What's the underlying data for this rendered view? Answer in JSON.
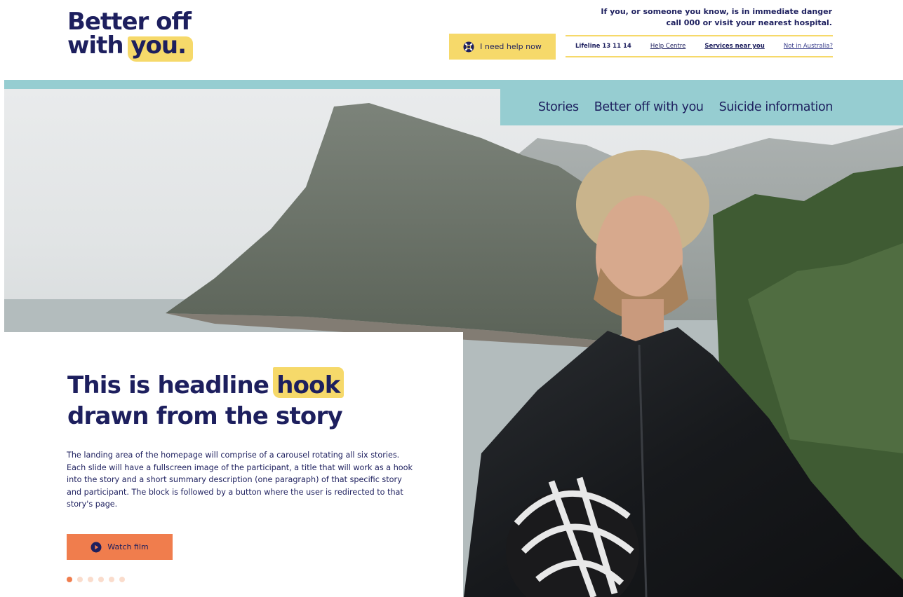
{
  "logo": {
    "line1": "Better off",
    "line2_pre": "with ",
    "line2_hl": "you."
  },
  "danger_notice": {
    "line1": "If you, or someone you know, is in immediate danger",
    "line2": "call 000 or visit your nearest hospital."
  },
  "help_button": {
    "label": "I need help now",
    "icon": "lifebuoy-icon"
  },
  "utility_links": {
    "lifeline": "Lifeline 13 11 14",
    "help_centre": "Help Centre",
    "services": "Services near you",
    "not_australia": "Not in Australia?"
  },
  "nav": {
    "items": [
      "Stories",
      "Better off with you",
      "Suicide information"
    ]
  },
  "hero": {
    "headline_pre": "This is headline ",
    "headline_hl": "hook",
    "headline_line2": "drawn from the story",
    "body": "The landing area of the homepage will comprise of a carousel rotating all six stories. Each slide will have a fullscreen image of the participant, a title that will work as a hook into the story and a short summary description (one paragraph) of that specific story and participant. The block is followed by a button where the user is redirected to that story's page.",
    "cta_label": "Watch film",
    "cta_icon": "play-icon",
    "slides_total": 6,
    "active_slide": 1
  },
  "colors": {
    "navy": "#1d1f5e",
    "yellow": "#f6d96a",
    "teal": "#96cdd1",
    "orange": "#f07d4d"
  }
}
